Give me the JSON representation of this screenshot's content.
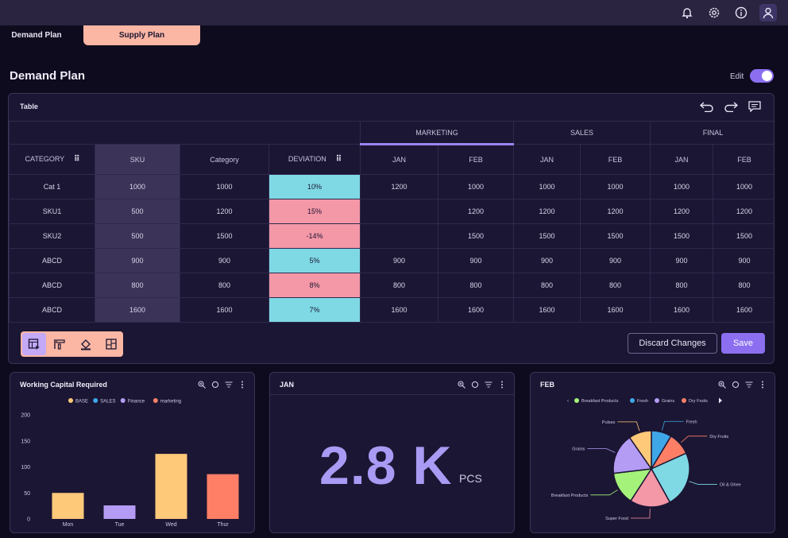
{
  "tabs": [
    {
      "label": "Demand Plan"
    },
    {
      "label": "Supply Plan"
    }
  ],
  "page": {
    "title": "Demand Plan",
    "edit_label": "Edit",
    "edit_on": true
  },
  "table": {
    "title": "Table",
    "group_headers": [
      "MARKETING",
      "SALES",
      "FINAL"
    ],
    "columns": [
      "CATEGORY",
      "SKU",
      "Category",
      "DEVIATION",
      "JAN",
      "FEB",
      "JAN",
      "FEB",
      "JAN",
      "FEB"
    ],
    "rows": [
      [
        "Cat 1",
        "1000",
        "1000",
        "10%",
        "1200",
        "1000",
        "1000",
        "1000",
        "1000",
        "1000"
      ],
      [
        "SKU1",
        "500",
        "1200",
        "15%",
        "",
        "1200",
        "1200",
        "1200",
        "1200",
        "1200"
      ],
      [
        "SKU2",
        "500",
        "1500",
        "-14%",
        "",
        "1500",
        "1500",
        "1500",
        "1500",
        "1500"
      ],
      [
        "ABCD",
        "900",
        "900",
        "5%",
        "900",
        "900",
        "900",
        "900",
        "900",
        "900"
      ],
      [
        "ABCD",
        "800",
        "800",
        "8%",
        "800",
        "800",
        "800",
        "800",
        "800",
        "800"
      ],
      [
        "ABCD",
        "1600",
        "1600",
        "7%",
        "1600",
        "1600",
        "1600",
        "1600",
        "1600",
        "1600"
      ]
    ],
    "deviation_colors": [
      "#7fd9e5",
      "#f497a7",
      "#f497a7",
      "#7fd9e5",
      "#f497a7",
      "#7fd9e5"
    ],
    "discard_label": "Discard Changes",
    "save_label": "Save"
  },
  "panels": {
    "working_capital": {
      "title": "Working Capital Required"
    },
    "jan": {
      "title": "JAN",
      "value": "2.8 K",
      "unit": "PCS"
    },
    "feb": {
      "title": "FEB"
    }
  },
  "chart_data": [
    {
      "type": "bar",
      "title": "Working Capital Required",
      "categories": [
        "Mon",
        "Tue",
        "Wed",
        "Thur"
      ],
      "values": [
        50,
        26,
        125,
        86
      ],
      "colors": [
        "#ffc97a",
        "#b49cf5",
        "#ffc97a",
        "#ff7f66"
      ],
      "ylim": [
        0,
        200
      ],
      "yticks": [
        0,
        50,
        100,
        150,
        200
      ],
      "legend": [
        {
          "name": "BASE",
          "color": "#ffc97a"
        },
        {
          "name": "SALES",
          "color": "#3fa7e8"
        },
        {
          "name": "Finance",
          "color": "#b49cf5"
        },
        {
          "name": "marketing",
          "color": "#ff7f66"
        }
      ],
      "legend_position": "top"
    },
    {
      "type": "pie",
      "title": "FEB",
      "legend": [
        {
          "name": "Breakfast Products",
          "color": "#a4f27a"
        },
        {
          "name": "Fresh",
          "color": "#3fa7e8"
        },
        {
          "name": "Grains",
          "color": "#b49cf5"
        },
        {
          "name": "Dry Fruits",
          "color": "#ff7f66"
        }
      ],
      "legend_position": "top",
      "slices": [
        {
          "label": "Fresh",
          "value": 8,
          "color": "#3fa7e8"
        },
        {
          "label": "Dry Fruits",
          "value": 9,
          "color": "#ff7f66"
        },
        {
          "label": "Oil & Ghee",
          "value": 22,
          "color": "#7fd9e5"
        },
        {
          "label": "Super Food",
          "value": 16,
          "color": "#f497a7"
        },
        {
          "label": "Breakfast Products",
          "value": 13,
          "color": "#a4f27a"
        },
        {
          "label": "Grains",
          "value": 16,
          "color": "#b49cf5"
        },
        {
          "label": "Pulses",
          "value": 9,
          "color": "#ffc97a"
        }
      ]
    }
  ]
}
